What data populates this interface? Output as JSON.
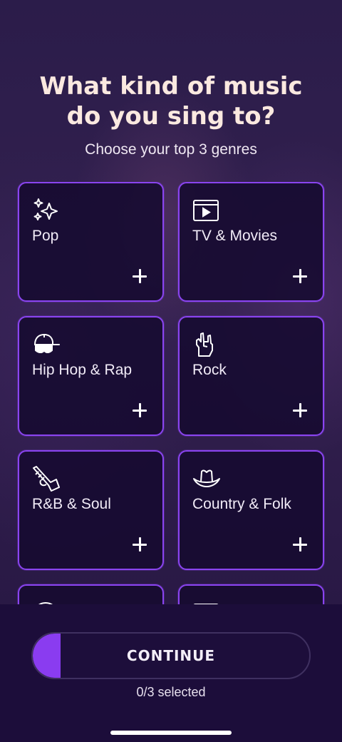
{
  "heading": "What kind of music do you sing to?",
  "subheading": "Choose your top 3 genres",
  "genres": [
    {
      "label": "Pop",
      "icon": "sparkles-icon"
    },
    {
      "label": "TV & Movies",
      "icon": "video-player-icon"
    },
    {
      "label": "Hip Hop & Rap",
      "icon": "cap-sunglasses-icon"
    },
    {
      "label": "Rock",
      "icon": "rock-hand-icon"
    },
    {
      "label": "R&B & Soul",
      "icon": "trumpet-icon"
    },
    {
      "label": "Country & Folk",
      "icon": "cowboy-hat-icon"
    },
    {
      "label": "",
      "icon": "headphones-icon"
    },
    {
      "label": "",
      "icon": "keyboard-icon"
    }
  ],
  "continue": {
    "label": "CONTINUE",
    "progress_fraction": 0.1,
    "selected_text": "0/3 selected"
  },
  "colors": {
    "accent": "#8a3cf0",
    "card_border": "#8a44f0",
    "card_bg": "#160a30",
    "heading": "#fbe9e0"
  }
}
